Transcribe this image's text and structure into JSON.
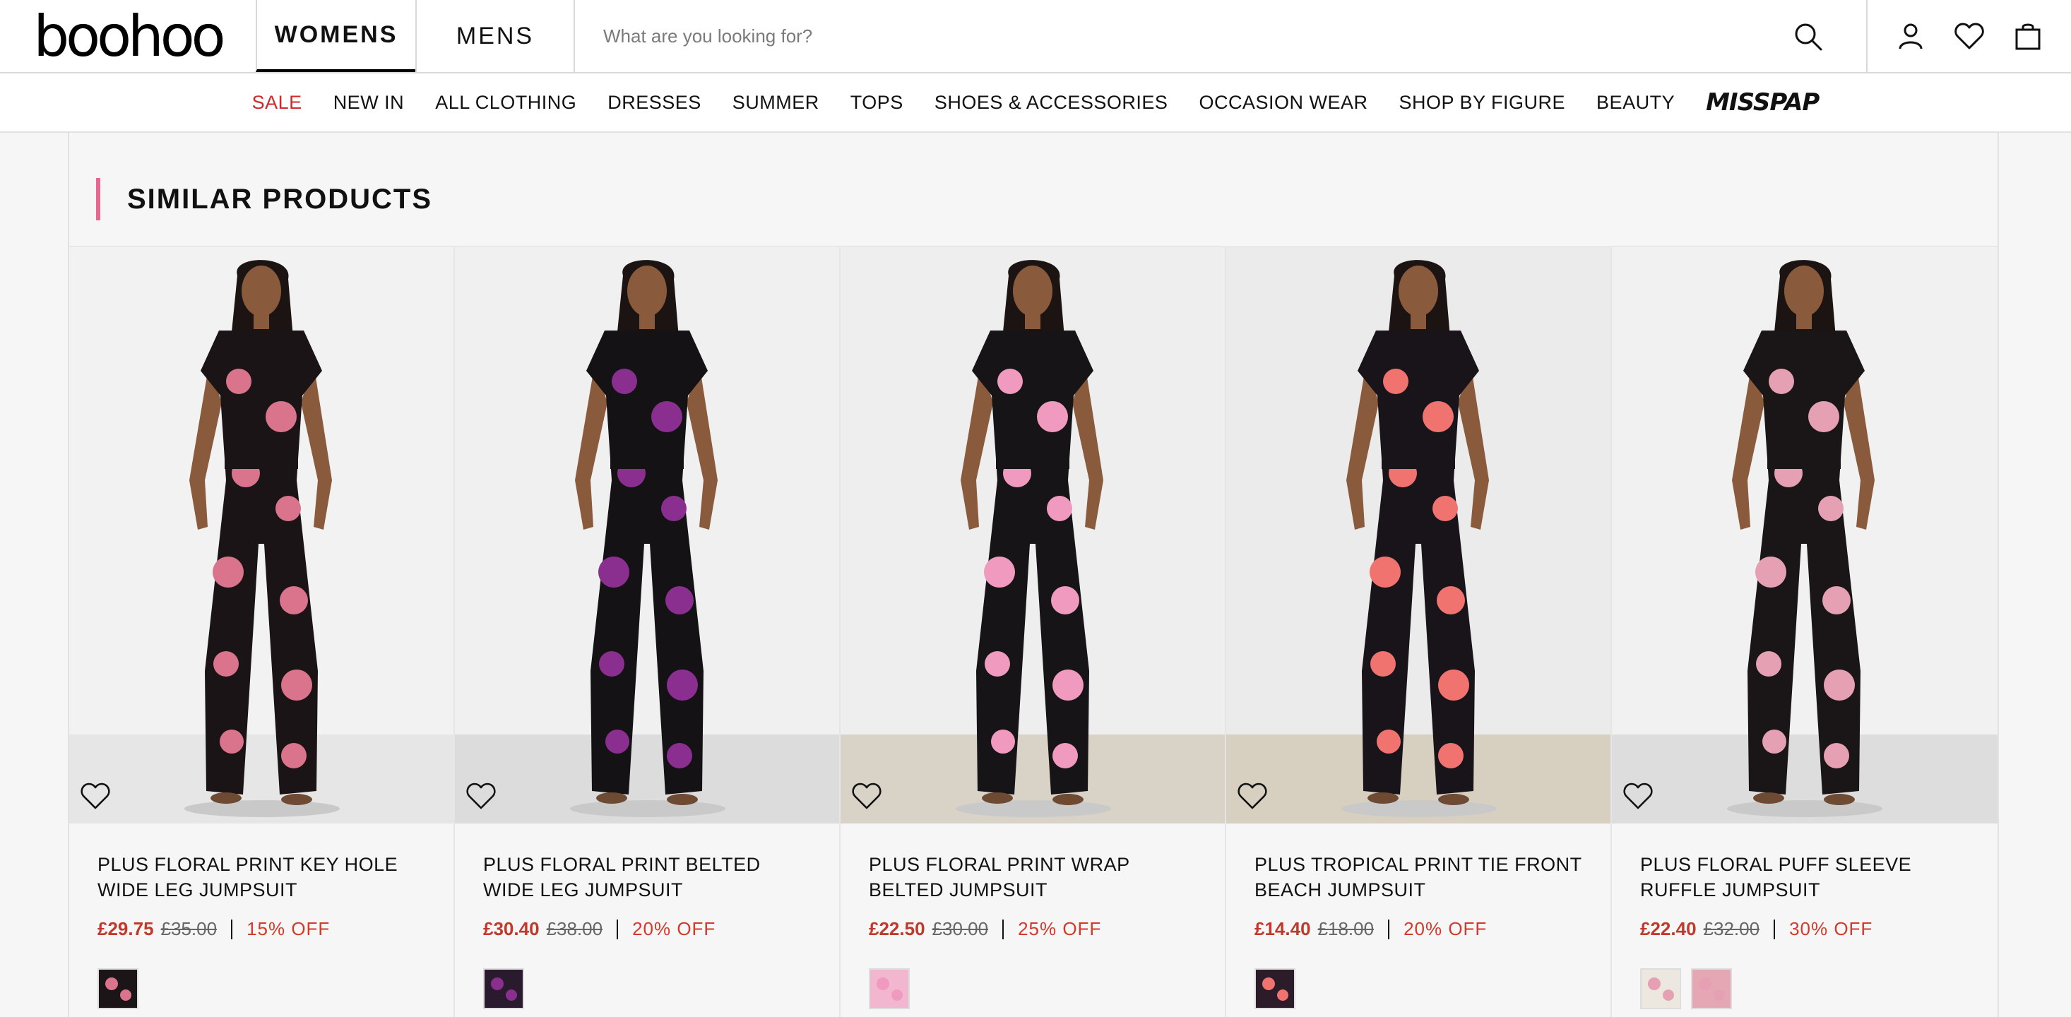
{
  "header": {
    "logo": "boohoo",
    "tabs": [
      {
        "label": "WOMENS",
        "active": true
      },
      {
        "label": "MENS",
        "active": false
      }
    ],
    "search_placeholder": "What are you looking for?"
  },
  "nav": {
    "items": [
      {
        "label": "SALE",
        "highlight": true
      },
      {
        "label": "NEW IN"
      },
      {
        "label": "ALL CLOTHING"
      },
      {
        "label": "DRESSES"
      },
      {
        "label": "SUMMER"
      },
      {
        "label": "TOPS"
      },
      {
        "label": "SHOES & ACCESSORIES"
      },
      {
        "label": "OCCASION WEAR"
      },
      {
        "label": "SHOP BY FIGURE"
      },
      {
        "label": "BEAUTY"
      },
      {
        "label": "MISSPAP",
        "logo": true
      }
    ]
  },
  "section": {
    "title": "SIMILAR PRODUCTS"
  },
  "products": [
    {
      "name": "PLUS FLORAL PRINT KEY HOLE WIDE LEG JUMPSUIT",
      "price": "£29.75",
      "was": "£35.00",
      "discount": "15% OFF",
      "bg": "#f2f2f2",
      "floor": "#e6e6e6",
      "garment": "#1a1416",
      "flower": "#d9748c",
      "swatches": [
        "#1b1517"
      ]
    },
    {
      "name": "PLUS FLORAL PRINT BELTED WIDE LEG JUMPSUIT",
      "price": "£30.40",
      "was": "£38.00",
      "discount": "20% OFF",
      "bg": "#f0f0f0",
      "floor": "#dcdcdc",
      "garment": "#141214",
      "flower": "#8a2f8f",
      "swatches": [
        "#2a1a2e"
      ]
    },
    {
      "name": "PLUS FLORAL PRINT WRAP BELTED JUMPSUIT",
      "price": "£22.50",
      "was": "£30.00",
      "discount": "25% OFF",
      "bg": "#eeeeee",
      "floor": "#d8d3c6",
      "garment": "#161416",
      "flower": "#f09ac0",
      "swatches": [
        "#f3b6cf"
      ]
    },
    {
      "name": "PLUS TROPICAL PRINT TIE FRONT BEACH JUMPSUIT",
      "price": "£14.40",
      "was": "£18.00",
      "discount": "20% OFF",
      "bg": "#ebebeb",
      "floor": "#d7d0c1",
      "garment": "#19141a",
      "flower": "#f0736f",
      "swatches": [
        "#2c1c2a"
      ]
    },
    {
      "name": "PLUS FLORAL PUFF SLEEVE RUFFLE JUMPSUIT",
      "price": "£22.40",
      "was": "£32.00",
      "discount": "30% OFF",
      "bg": "#f1f1f1",
      "floor": "#dddddd",
      "garment": "#1a1516",
      "flower": "#e6a0b4",
      "swatches": [
        "#ece8e0",
        "#e4a7b3"
      ]
    }
  ]
}
